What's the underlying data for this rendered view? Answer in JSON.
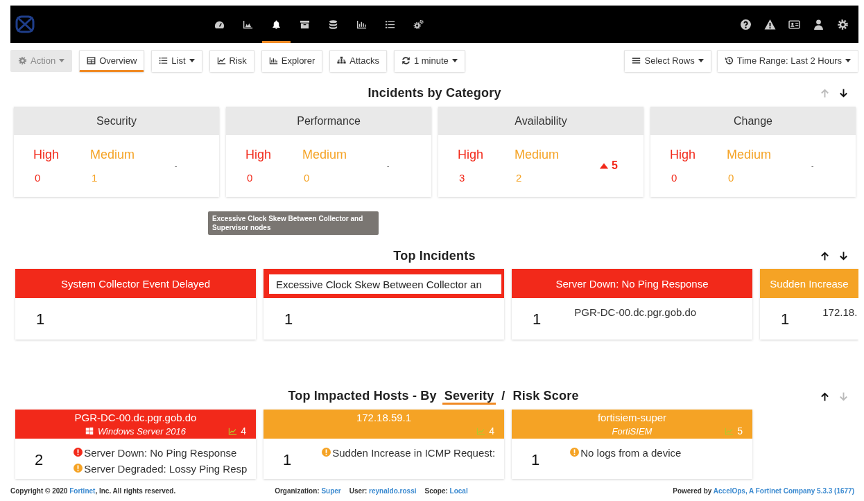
{
  "header": {
    "nav": [
      {
        "selected": false
      },
      {
        "selected": false
      },
      {
        "selected": true
      },
      {
        "selected": false
      },
      {
        "selected": false
      },
      {
        "selected": false
      },
      {
        "selected": false
      },
      {
        "selected": false
      }
    ]
  },
  "toolbar": {
    "left": [
      {
        "label": "Action",
        "kind": "dropdown",
        "selected": false,
        "disabled": true
      },
      {
        "label": "Overview",
        "kind": "button",
        "selected": true,
        "disabled": false
      },
      {
        "label": "List",
        "kind": "dropdown",
        "selected": false,
        "disabled": false
      },
      {
        "label": "Risk",
        "kind": "button",
        "selected": false,
        "disabled": false
      },
      {
        "label": "Explorer",
        "kind": "button",
        "selected": false,
        "disabled": false
      },
      {
        "label": "Attacks",
        "kind": "button",
        "selected": false,
        "disabled": false
      },
      {
        "label": "1 minute",
        "kind": "dropdown",
        "selected": false,
        "disabled": false
      }
    ],
    "right": [
      {
        "label": "Select Rows",
        "kind": "dropdown",
        "selected": false,
        "disabled": false
      },
      {
        "label": "Time Range: Last 2 Hours",
        "kind": "dropdown",
        "selected": false,
        "disabled": false
      }
    ]
  },
  "incidents_by_category": {
    "title": "Incidents by Category",
    "up_enabled": false,
    "down_enabled": true,
    "categories": [
      {
        "name": "Security",
        "high_label": "High",
        "high": "0",
        "medium_label": "Medium",
        "medium": "1",
        "change": {
          "kind": "none",
          "text": "-"
        }
      },
      {
        "name": "Performance",
        "high_label": "High",
        "high": "0",
        "medium_label": "Medium",
        "medium": "0",
        "change": {
          "kind": "none",
          "text": "-"
        }
      },
      {
        "name": "Availability",
        "high_label": "High",
        "high": "3",
        "medium_label": "Medium",
        "medium": "2",
        "change": {
          "kind": "up",
          "text": "5"
        }
      },
      {
        "name": "Change",
        "high_label": "High",
        "high": "0",
        "medium_label": "Medium",
        "medium": "0",
        "change": {
          "kind": "none",
          "text": "-"
        }
      }
    ]
  },
  "tooltip": {
    "text": "Excessive Clock Skew Between Collector and Supervisor nodes"
  },
  "top_incidents": {
    "title": "Top Incidents",
    "up_enabled": true,
    "down_enabled": true,
    "cards": [
      {
        "title": "System Collector Event Delayed",
        "color": "#f2291a",
        "hovered": false,
        "count": "1"
      },
      {
        "title": "Excessive Clock Skew Between Collector an",
        "color": "#f2291a",
        "hovered": true,
        "count": "1"
      },
      {
        "title": "Server Down: No Ping Response",
        "color": "#f2291a",
        "hovered": false,
        "count": "1",
        "host": "PGR-DC-00.dc.pgr.gob.do"
      },
      {
        "title": "Sudden Increase",
        "color": "#f5a325",
        "hovered": false,
        "count": "1",
        "host": "172.18."
      }
    ]
  },
  "top_impacted_hosts": {
    "title": "Top Impacted Hosts - By",
    "separator": "/",
    "up_enabled": true,
    "down_enabled": false,
    "sort_options": [
      {
        "label": "Severity",
        "selected": true
      },
      {
        "label": "Risk Score",
        "selected": false
      }
    ],
    "hosts": [
      {
        "name": "PGR-DC-00.dc.pgr.gob.do",
        "os": {
          "text": "Windows Server 2016",
          "kind": "windows"
        },
        "color": "#f2291a",
        "risk": "4",
        "count": "2",
        "incidents": [
          {
            "text": "Server Down: No Ping Response",
            "color": "#f2291a"
          },
          {
            "text": "Server Degraded: Lossy Ping Resp",
            "color": "#f5a325"
          }
        ]
      },
      {
        "name": "172.18.59.1",
        "color": "#f5a325",
        "risk": "4",
        "count": "1",
        "incidents": [
          {
            "text": "Sudden Increase in ICMP Request:",
            "color": "#f5a325"
          }
        ]
      },
      {
        "name": "fortisiem-super",
        "os": {
          "text": "FortiSIEM",
          "kind": "plain"
        },
        "color": "#f5a325",
        "risk": "5",
        "count": "1",
        "incidents": [
          {
            "text": "No logs from a device",
            "color": "#f5a325"
          }
        ]
      }
    ]
  },
  "footer": {
    "copyright": {
      "before": "Copyright © 2020 ",
      "link": "Fortinet",
      "after": ", Inc. All rights reserved."
    },
    "context": [
      {
        "label": "Organization:",
        "value": "Super"
      },
      {
        "label": "User:",
        "value": "reynaldo.rossi"
      },
      {
        "label": "Scope:",
        "value": "Local"
      }
    ],
    "powered": {
      "label": "Powered by",
      "link": "AccelOps, A Fortinet Company 5.3.3 (1677)"
    }
  }
}
